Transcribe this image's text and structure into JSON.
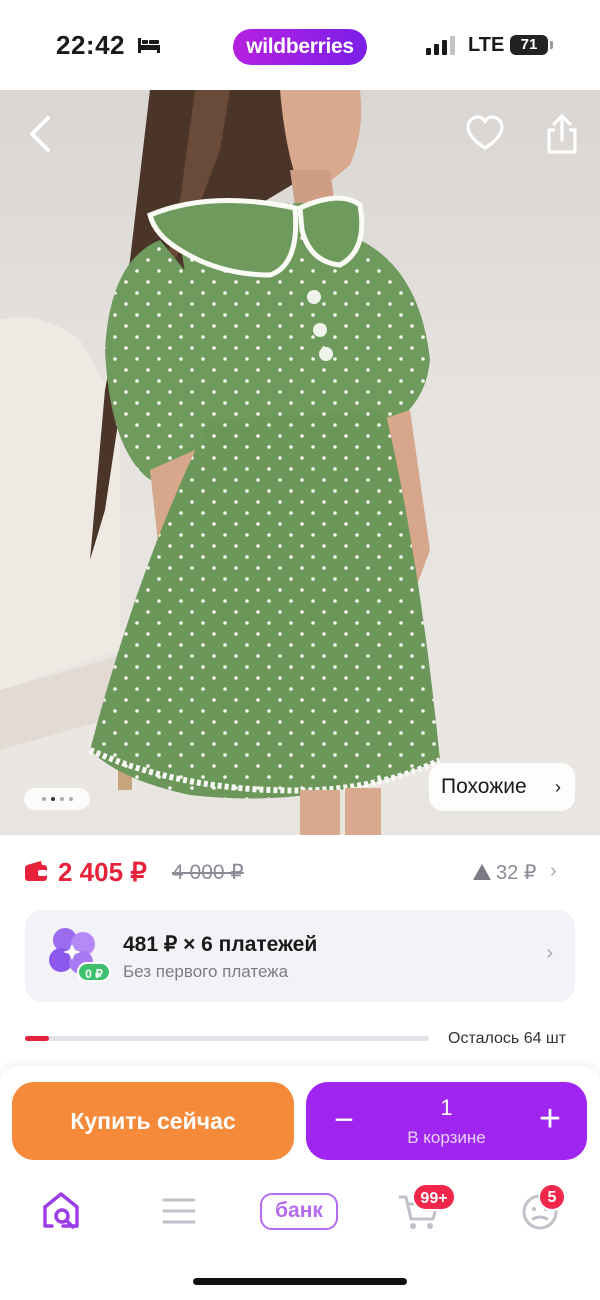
{
  "status_bar": {
    "time": "22:42",
    "brand": "wildberries",
    "network": "LTE",
    "battery": "71"
  },
  "photo": {
    "similar_label": "Похожие",
    "similar_chevron": "›",
    "gallery_total": 4,
    "gallery_active": 2
  },
  "price": {
    "current": "2 405 ₽",
    "old": "4 000 ₽",
    "drop": "32 ₽",
    "chevron": "›"
  },
  "installment": {
    "title": "481 ₽ × 6 платежей",
    "subtitle": "Без первого платежа",
    "badge": "0 ₽",
    "chevron": "›"
  },
  "stock": {
    "text": "Осталось 64 шт",
    "fill_fraction": 0.06
  },
  "actions": {
    "buy_label": "Купить сейчас",
    "minus": "−",
    "plus": "+",
    "quantity": "1",
    "cart_label": "В корзине"
  },
  "tabbar": {
    "bank_label": "банк",
    "cart_badge": "99+",
    "profile_badge": "5"
  },
  "colors": {
    "brand_gradient_start": "#b620e0",
    "brand_gradient_end": "#7b1fe8",
    "price_red": "#e8213b",
    "buy_orange": "#f58a3a",
    "cart_purple": "#a125f0",
    "dress_green": "#6f9a5e"
  },
  "icons": [
    "bed-icon",
    "signal-icon",
    "back-chevron-icon",
    "heart-icon",
    "share-icon",
    "wallet-icon",
    "price-down-triangle-icon",
    "clover-icon",
    "home-search-icon",
    "catalog-menu-icon",
    "cart-icon",
    "profile-icon"
  ]
}
